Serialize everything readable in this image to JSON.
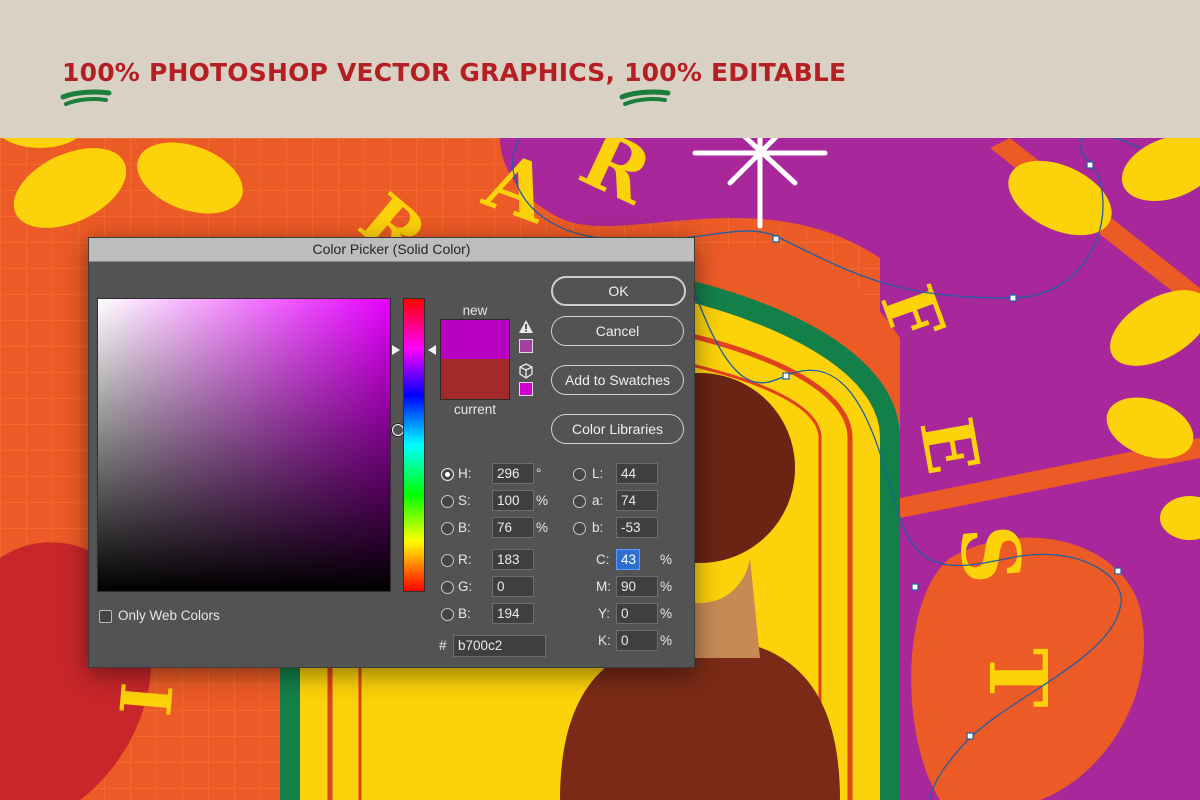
{
  "banner": {
    "headline": "100% PHOTOSHOP VECTOR GRAPHICS, 100% EDITABLE",
    "text_color": "#b51f24",
    "accent_color": "#1a7f3a"
  },
  "artwork": {
    "background_colors": [
      "#ec5a25",
      "#a8279a",
      "#fcd20a",
      "#13804a"
    ],
    "letters": [
      "A",
      "R",
      "T",
      "F",
      "E",
      "S",
      "T"
    ]
  },
  "dialog": {
    "title": "Color Picker (Solid Color)",
    "new_label": "new",
    "current_label": "current",
    "new_color": "#b700c2",
    "current_color": "#a3292a",
    "buttons": {
      "ok": "OK",
      "cancel": "Cancel",
      "add_to_swatches": "Add to Swatches",
      "color_libraries": "Color Libraries"
    },
    "only_web_colors": "Only Web Colors",
    "only_web_colors_checked": false,
    "selected_mode": "H",
    "hsb": [
      {
        "label": "H:",
        "value": "296",
        "unit": "°"
      },
      {
        "label": "S:",
        "value": "100",
        "unit": "%"
      },
      {
        "label": "B:",
        "value": "76",
        "unit": "%"
      }
    ],
    "rgb": [
      {
        "label": "R:",
        "value": "183"
      },
      {
        "label": "G:",
        "value": "0"
      },
      {
        "label": "B:",
        "value": "194"
      }
    ],
    "lab": [
      {
        "label": "L:",
        "value": "44"
      },
      {
        "label": "a:",
        "value": "74"
      },
      {
        "label": "b:",
        "value": "-53"
      }
    ],
    "cmyk": [
      {
        "label": "C:",
        "value": "43",
        "unit": "%"
      },
      {
        "label": "M:",
        "value": "90",
        "unit": "%"
      },
      {
        "label": "Y:",
        "value": "0",
        "unit": "%"
      },
      {
        "label": "K:",
        "value": "0",
        "unit": "%"
      }
    ],
    "hex_prefix": "#",
    "hex": "b700c2",
    "icons": [
      "warning-icon",
      "websafe-cube-icon"
    ]
  }
}
